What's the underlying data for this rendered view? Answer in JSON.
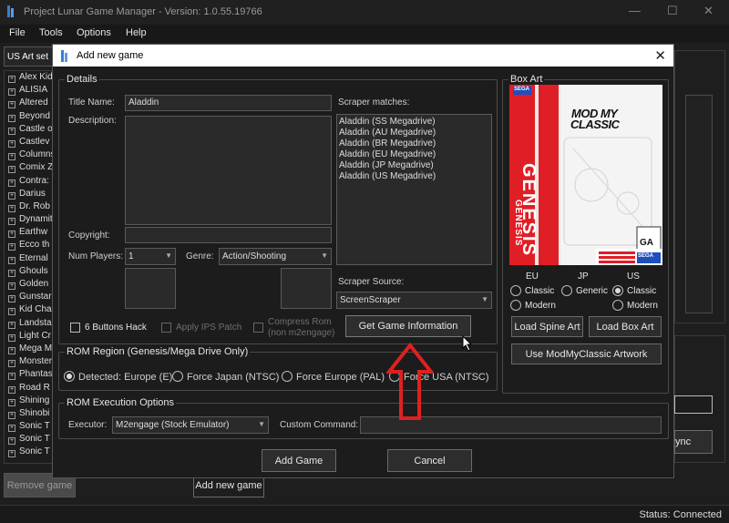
{
  "app": {
    "title": "Project Lunar Game Manager - Version: 1.0.55.19766",
    "window_controls": {
      "minimize": "—",
      "maximize": "☐",
      "close": "✕"
    },
    "menu": [
      "File",
      "Tools",
      "Options",
      "Help"
    ],
    "art_set": "US Art set",
    "game_list": [
      "Alex Kid",
      "ALISIA",
      "Altered",
      "Beyond",
      "Castle o",
      "Castlev",
      "Columns",
      "Comix Z",
      "Contra:",
      "Darius",
      "Dr. Rob",
      "Dynamit",
      "Earthw",
      "Ecco th",
      "Eternal",
      "Ghouls",
      "Golden",
      "Gunstar",
      "Kid Cha",
      "Landsta",
      "Light Cr",
      "Mega M",
      "Monster",
      "Phantas",
      "Road R",
      "Shining",
      "Shinobi",
      "Sonic T",
      "Sonic T",
      "Sonic T"
    ],
    "remove_game": "Remove game",
    "add_new_game": "Add new game",
    "sync_partial": "ync",
    "status": "Status: Connected"
  },
  "dialog": {
    "title": "Add new game",
    "close": "✕",
    "details": {
      "legend": "Details",
      "title_label": "Title Name:",
      "title_value": "Aladdin",
      "description_label": "Description:",
      "copyright_label": "Copyright:",
      "num_players_label": "Num Players:",
      "num_players_value": "1",
      "genre_label": "Genre:",
      "genre_value": "Action/Shooting",
      "scraper_matches_label": "Scraper matches:",
      "scraper_matches": [
        "Aladdin (SS Megadrive)",
        "Aladdin (AU Megadrive)",
        "Aladdin (BR Megadrive)",
        "Aladdin (EU Megadrive)",
        "Aladdin (JP Megadrive)",
        "Aladdin (US Megadrive)"
      ],
      "scraper_source_label": "Scraper Source:",
      "scraper_source_value": "ScreenScraper",
      "six_buttons": "6 Buttons Hack",
      "apply_ips": "Apply IPS Patch",
      "compress_rom": "Compress Rom",
      "compress_rom_sub": "(non m2engage)",
      "get_info": "Get Game Information"
    },
    "rom_region": {
      "legend": "ROM Region (Genesis/Mega Drive Only)",
      "options": [
        "Detected: Europe (E)",
        "Force Japan (NTSC)",
        "Force Europe (PAL)",
        "Force USA (NTSC)"
      ],
      "selected": 0
    },
    "rom_exec": {
      "legend": "ROM Execution Options",
      "executor_label": "Executor:",
      "executor_value": "M2engage (Stock Emulator)",
      "custom_command_label": "Custom Command:",
      "custom_command_value": ""
    },
    "box_art": {
      "legend": "Box Art",
      "regions": [
        "EU",
        "JP",
        "US"
      ],
      "options": {
        "eu": [
          "Classic",
          "Modern"
        ],
        "jp": [
          "Generic"
        ],
        "us": [
          "Classic",
          "Modern"
        ]
      },
      "selected_us": "Classic",
      "load_spine": "Load Spine Art",
      "load_box": "Load Box Art",
      "use_mmc": "Use ModMyClassic Artwork",
      "cover_text": {
        "brand_line1": "MOD MY",
        "brand_line2": "CLASSIC",
        "console": "GENESIS",
        "spine": "GENESIS",
        "sega_top": "SEGA",
        "sega_bottom": "SEGA",
        "rating": "GA"
      }
    },
    "add_game": "Add Game",
    "cancel": "Cancel"
  },
  "colors": {
    "genesis_red": "#e01e26",
    "dark_bg": "#1c1c1c",
    "annotation_red": "#e02020"
  }
}
